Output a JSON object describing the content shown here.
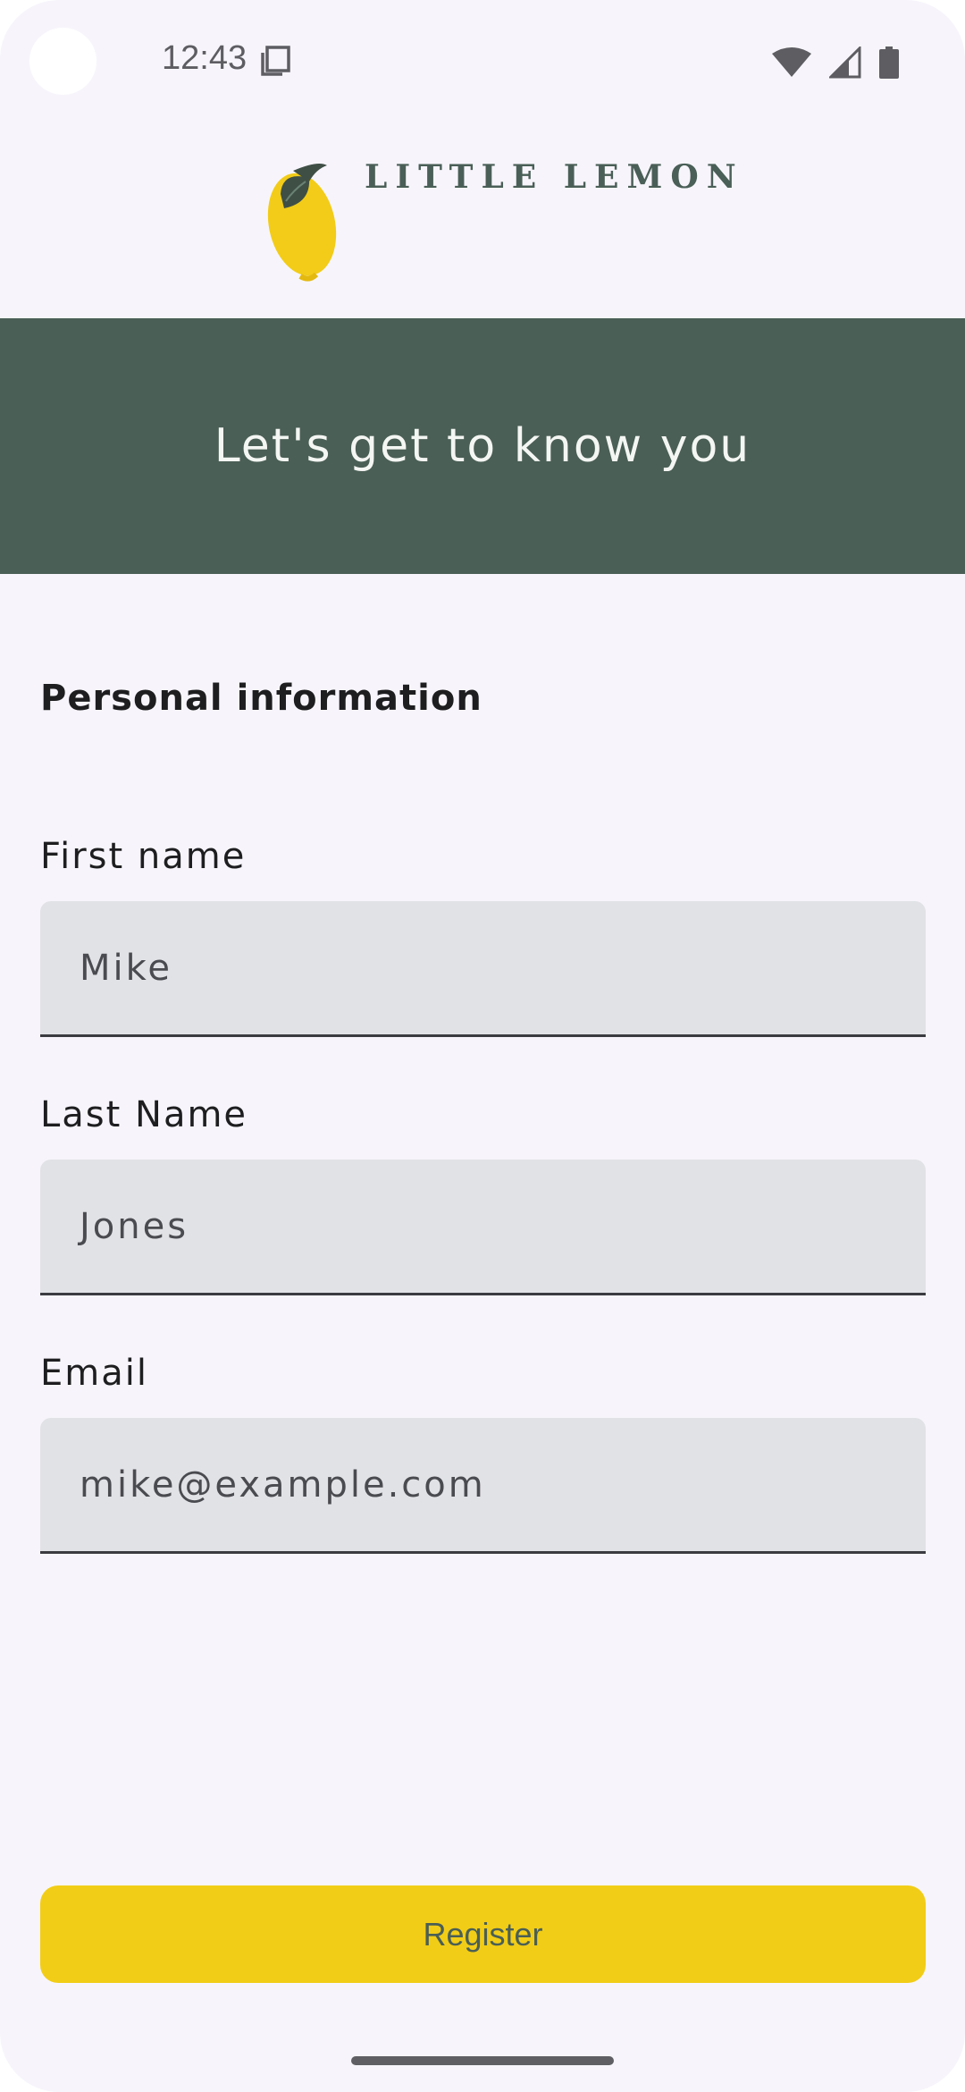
{
  "status_bar": {
    "time": "12:43"
  },
  "header": {
    "brand": "LITTLE LEMON"
  },
  "hero": {
    "title": "Let's get to know you"
  },
  "form": {
    "section_title": "Personal information",
    "first_name": {
      "label": "First name",
      "value": "Mike"
    },
    "last_name": {
      "label": "Last Name",
      "value": "Jones"
    },
    "email": {
      "label": "Email",
      "value": "mike@example.com"
    }
  },
  "actions": {
    "register_label": "Register"
  },
  "colors": {
    "brand_green": "#4a5f56",
    "brand_yellow": "#f2cd17",
    "background": "#f7f5fb",
    "field_fill": "#e1e2e6"
  },
  "icons": [
    "copy-icon",
    "wifi-icon",
    "cell-signal-icon",
    "battery-icon",
    "lemon-logo-icon"
  ]
}
